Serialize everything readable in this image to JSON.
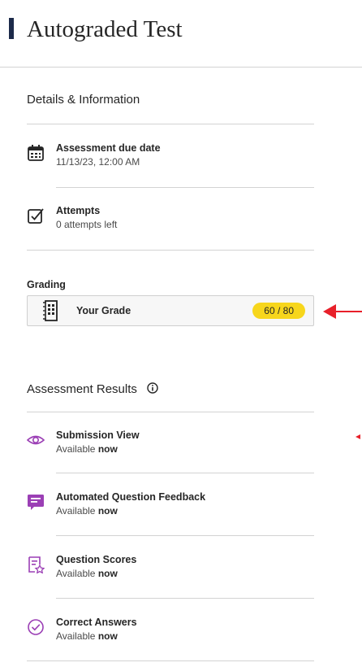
{
  "page": {
    "title": "Autograded Test"
  },
  "details": {
    "heading": "Details & Information",
    "items": [
      {
        "title": "Assessment due date",
        "subtitle": "11/13/23, 12:00 AM",
        "icon": "calendar-icon"
      },
      {
        "title": "Attempts",
        "subtitle": "0 attempts left",
        "icon": "checkbox-icon"
      }
    ]
  },
  "grading": {
    "label": "Grading",
    "card_label": "Your Grade",
    "grade": "60 / 80",
    "icon": "grade-book-icon",
    "pill_color": "#f7d61c"
  },
  "results": {
    "heading": "Assessment Results",
    "info_icon": "info-icon",
    "accent_color": "#9b3fb5",
    "items": [
      {
        "title": "Submission View",
        "prefix": "Available ",
        "status": "now",
        "icon": "eye-icon"
      },
      {
        "title": "Automated Question Feedback",
        "prefix": "Available ",
        "status": "now",
        "icon": "feedback-icon"
      },
      {
        "title": "Question Scores",
        "prefix": "Available ",
        "status": "now",
        "icon": "question-scores-icon"
      },
      {
        "title": "Correct Answers",
        "prefix": "Available ",
        "status": "now",
        "icon": "check-circle-icon"
      }
    ]
  },
  "annotations": {
    "arrow_color": "#e8202a"
  }
}
